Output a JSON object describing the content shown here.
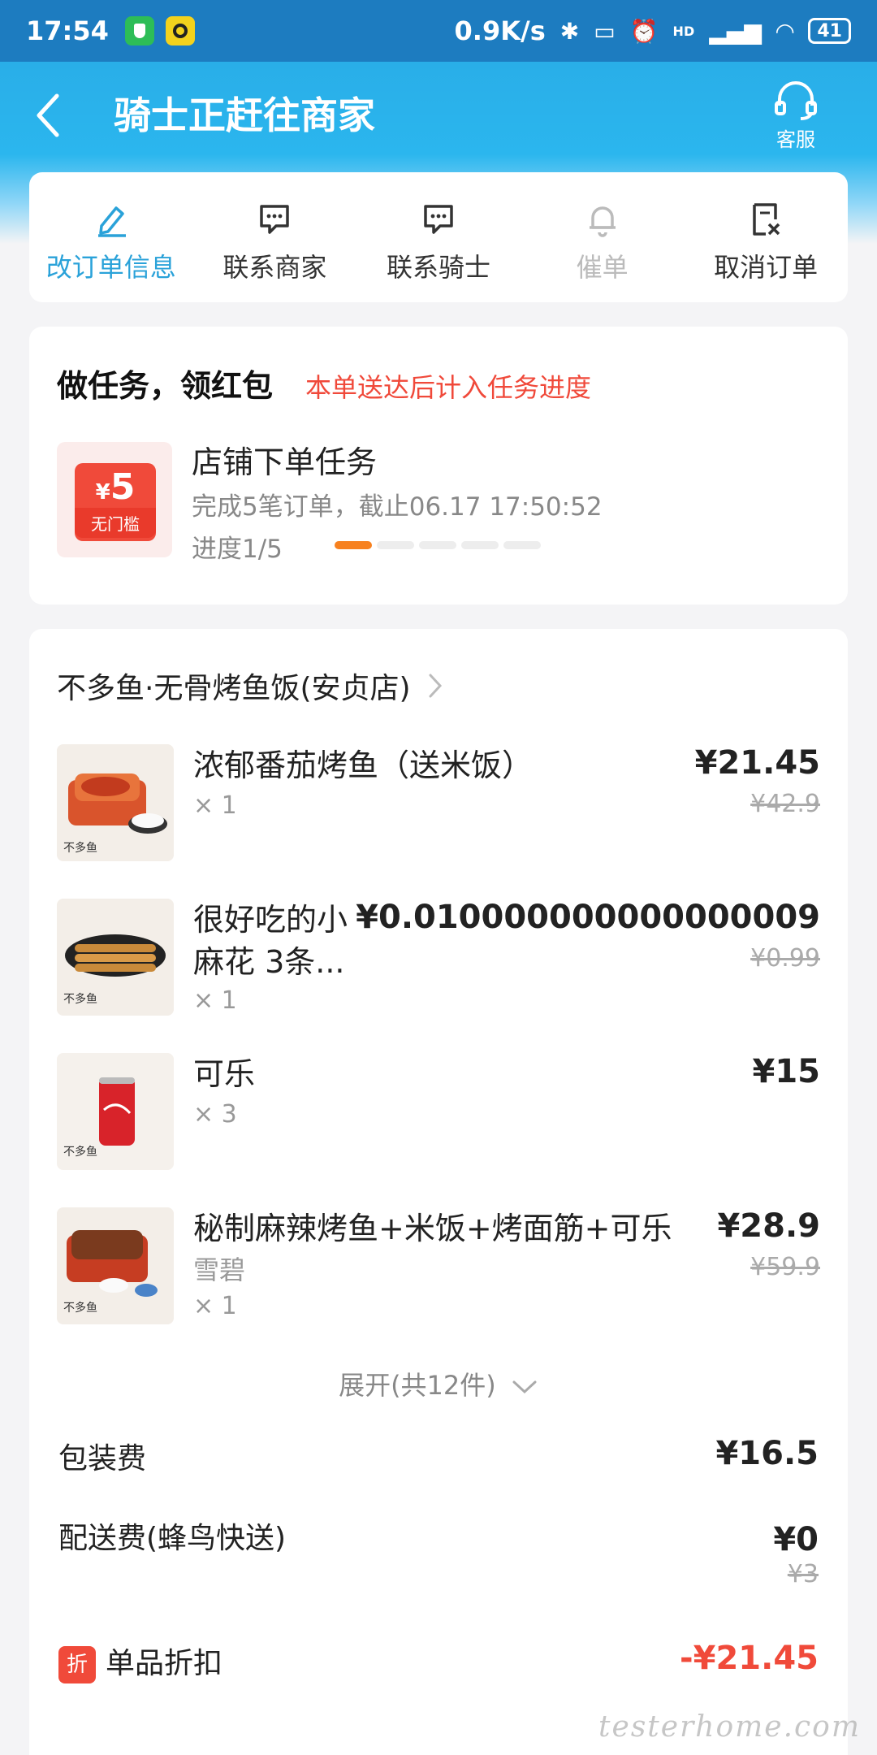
{
  "status_bar": {
    "time": "17:54",
    "net_speed": "0.9K/s",
    "battery": "41",
    "hd_label": "HD"
  },
  "header": {
    "title": "骑士正赶往商家",
    "service_label": "客服"
  },
  "actions": [
    {
      "label": "改订单信息",
      "icon": "edit-icon",
      "state": "active"
    },
    {
      "label": "联系商家",
      "icon": "chat-icon",
      "state": "normal"
    },
    {
      "label": "联系骑士",
      "icon": "chat-icon",
      "state": "normal"
    },
    {
      "label": "催单",
      "icon": "bell-icon",
      "state": "disabled"
    },
    {
      "label": "取消订单",
      "icon": "cancel-doc-icon",
      "state": "normal"
    }
  ],
  "task": {
    "title": "做任务，领红包",
    "subtitle": "本单送达后计入任务进度",
    "coupon_amount": "5",
    "coupon_currency": "¥",
    "coupon_label": "无门槛",
    "name": "店铺下单任务",
    "description": "完成5笔订单，截止06.17 17:50:52",
    "progress_text": "进度1/5",
    "progress_done": 1,
    "progress_total": 5
  },
  "order": {
    "shop_name": "不多鱼·无骨烤鱼饭(安贞店)",
    "items": [
      {
        "name": "浓郁番茄烤鱼（送米饭）",
        "qty": "× 1",
        "price": "¥21.45",
        "original": "¥42.9"
      },
      {
        "name": "很好吃的小麻花 3条...",
        "name_line1": "很好吃的小",
        "name_line2": "麻花 3条...",
        "qty": "× 1",
        "price": "¥0.010000000000000009",
        "original": "¥0.99"
      },
      {
        "name": "可乐",
        "qty": "× 3",
        "price": "¥15",
        "original": ""
      },
      {
        "name": "秘制麻辣烤鱼+米饭+烤面筋+可乐",
        "spec": "雪碧",
        "qty": "× 1",
        "price": "¥28.9",
        "original": "¥59.9"
      }
    ],
    "expand_label": "展开(共12件)",
    "packaging_label": "包装费",
    "packaging_fee": "¥16.5",
    "delivery_label": "配送费(蜂鸟快送)",
    "delivery_fee": "¥0",
    "delivery_original": "¥3",
    "discount_badge": "折",
    "discount_label": "单品折扣",
    "discount_value": "-¥21.45"
  },
  "watermark": "testerhome.com",
  "colors": {
    "brand_blue": "#2aa2d9",
    "accent_red": "#f04a3a",
    "progress_orange": "#f7811f"
  }
}
